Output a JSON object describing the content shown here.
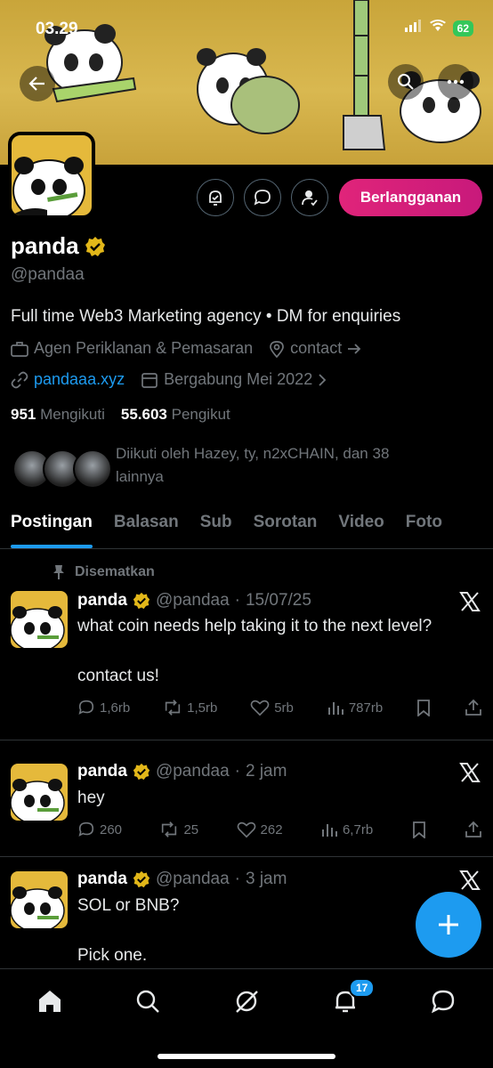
{
  "status_bar": {
    "time": "03.29",
    "battery": "62"
  },
  "profile": {
    "name": "panda",
    "handle": "@pandaa",
    "bio": "Full time Web3 Marketing agency • DM for enquiries",
    "category": "Agen Periklanan & Pemasaran",
    "contact": "contact",
    "website": "pandaaa.xyz",
    "joined": "Bergabung Mei 2022",
    "following_count": "951",
    "following_label": "Mengikuti",
    "followers_count": "55.603",
    "followers_label": "Pengikut",
    "followed_by": "Diikuti oleh Hazey, ty, n2xCHAIN, dan 38 lainnya",
    "subscribe_label": "Berlangganan"
  },
  "tabs": [
    "Postingan",
    "Balasan",
    "Sub",
    "Sorotan",
    "Video",
    "Foto"
  ],
  "pinned_label": "Disematkan",
  "posts": [
    {
      "name": "panda",
      "handle": "@pandaa",
      "time": "15/07/25",
      "line1": "what coin needs help taking it to the next level?",
      "line2": "contact us!",
      "replies": "1,6rb",
      "reposts": "1,5rb",
      "likes": "5rb",
      "views": "787rb"
    },
    {
      "name": "panda",
      "handle": "@pandaa",
      "time": "2 jam",
      "line1": "hey",
      "replies": "260",
      "reposts": "25",
      "likes": "262",
      "views": "6,7rb"
    },
    {
      "name": "panda",
      "handle": "@pandaa",
      "time": "3 jam",
      "line1": "SOL or BNB?",
      "line2": "Pick one."
    }
  ],
  "notifications_badge": "17",
  "colors": {
    "accent": "#1d9bf0",
    "subscribe": "#e0247a",
    "verified": "#e2b719"
  }
}
